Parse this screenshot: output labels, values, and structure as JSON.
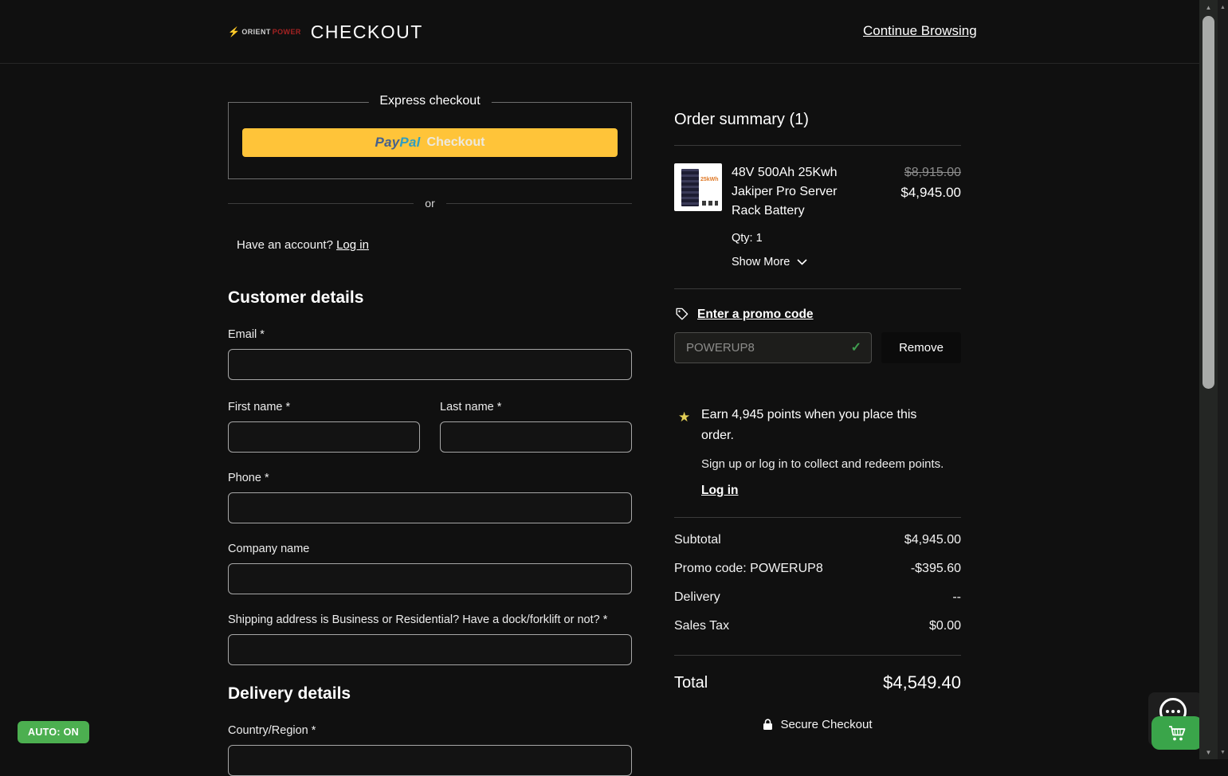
{
  "header": {
    "brand_orient": "ORIENT",
    "brand_power": "POWER",
    "title": "CHECKOUT",
    "continue_browsing": "Continue Browsing"
  },
  "express": {
    "legend": "Express checkout",
    "paypal_pay": "Pay",
    "paypal_pal": "Pal",
    "paypal_checkout": "Checkout",
    "or_divider": "or",
    "have_account": "Have an account?",
    "login_link": "Log in"
  },
  "customer_details": {
    "heading": "Customer details",
    "email_label": "Email *",
    "first_name_label": "First name *",
    "last_name_label": "Last name *",
    "phone_label": "Phone *",
    "company_label": "Company name",
    "shipping_question_label": "Shipping address is Business or Residential? Have a dock/forklift or not? *"
  },
  "delivery_details": {
    "heading": "Delivery details",
    "country_label": "Country/Region *"
  },
  "order_summary": {
    "heading": "Order summary (1)",
    "item": {
      "name": "48V 500Ah 25Kwh Jakiper Pro Server Rack Battery",
      "original_price": "$8,915.00",
      "price": "$4,945.00",
      "qty": "Qty: 1",
      "show_more": "Show More",
      "image_label": "25kWh"
    },
    "promo": {
      "link_label": "Enter a promo code",
      "code": "POWERUP8",
      "remove_label": "Remove"
    },
    "points": {
      "earn_text": "Earn 4,945 points when you place this order.",
      "signup_text": "Sign up or log in to collect and redeem points.",
      "login_link": "Log in"
    },
    "totals": [
      {
        "label": "Subtotal",
        "value": "$4,945.00"
      },
      {
        "label": "Promo code: POWERUP8",
        "value": "-$395.60"
      },
      {
        "label": "Delivery",
        "value": "--"
      },
      {
        "label": "Sales Tax",
        "value": "$0.00"
      }
    ],
    "total_label": "Total",
    "total_value": "$4,549.40",
    "secure_label": "Secure Checkout"
  },
  "overlays": {
    "auto_badge": "AUTO: ON"
  },
  "icons": {
    "bolt": "⚡",
    "star": "★",
    "check": "✓",
    "up_arrow": "▲",
    "down_arrow": "▼"
  },
  "colors": {
    "paypal_yellow": "#FFC439",
    "badge_green": "#4CAF50",
    "cart_green": "#3aa54a",
    "check_green": "#3f9d4f",
    "brand_red": "#e23b2e"
  }
}
